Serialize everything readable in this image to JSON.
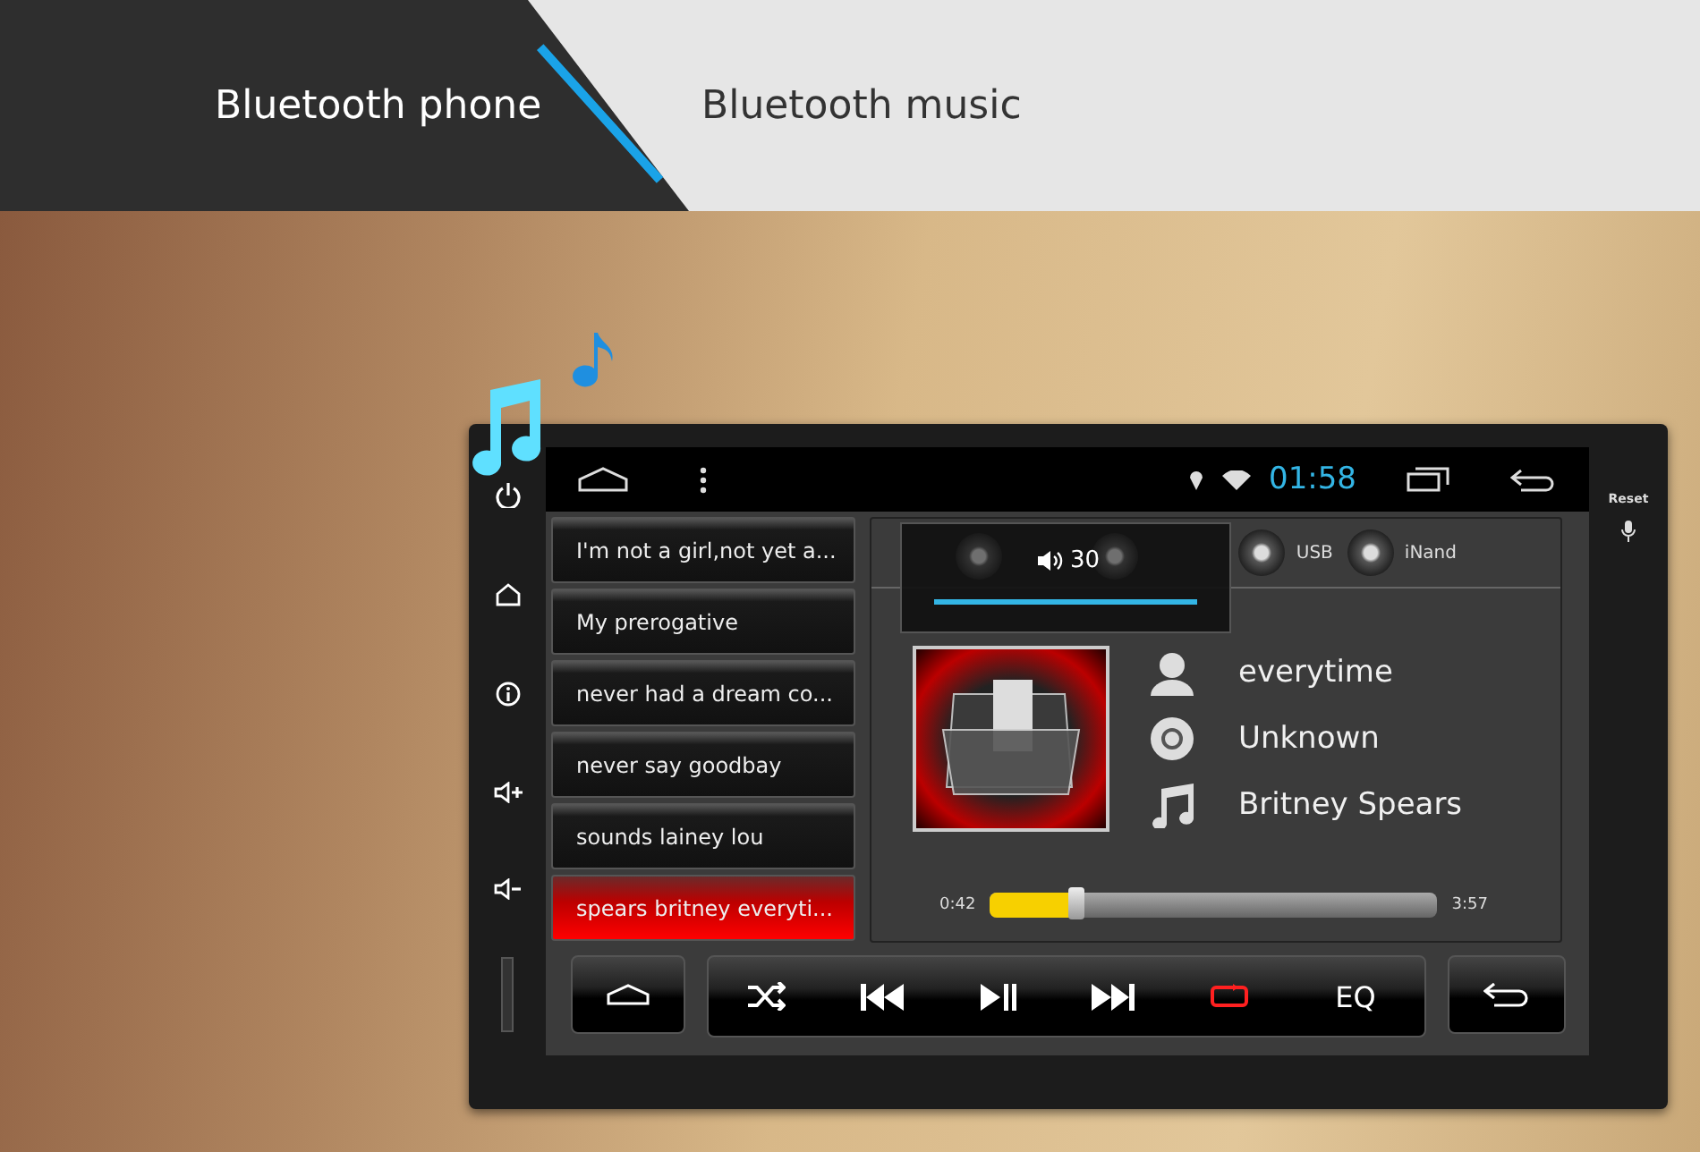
{
  "tabs": [
    {
      "label": "Bluetooth phone",
      "selected": true
    },
    {
      "label": "Bluetooth music",
      "selected": false
    }
  ],
  "device": {
    "side_label": "Reset"
  },
  "status_bar": {
    "time": "01:58"
  },
  "playlist": [
    {
      "title": "I'm not a girl,not yet a...",
      "selected": false
    },
    {
      "title": "My prerogative",
      "selected": false
    },
    {
      "title": "never had a dream co...",
      "selected": false
    },
    {
      "title": "never say goodbay",
      "selected": false
    },
    {
      "title": "sounds lainey lou",
      "selected": false
    },
    {
      "title": "spears britney everyti...",
      "selected": true
    }
  ],
  "volume_popup": {
    "value": "30",
    "level": 1
  },
  "sources": [
    {
      "label": "USB"
    },
    {
      "label": "iNand"
    }
  ],
  "track": {
    "title": "everytime",
    "album": "Unknown",
    "artist": "Britney Spears"
  },
  "progress": {
    "elapsed": "0:42",
    "total": "3:57",
    "level": 0.19
  },
  "controls": {
    "repeat_on": true,
    "eq_label": "EQ"
  }
}
